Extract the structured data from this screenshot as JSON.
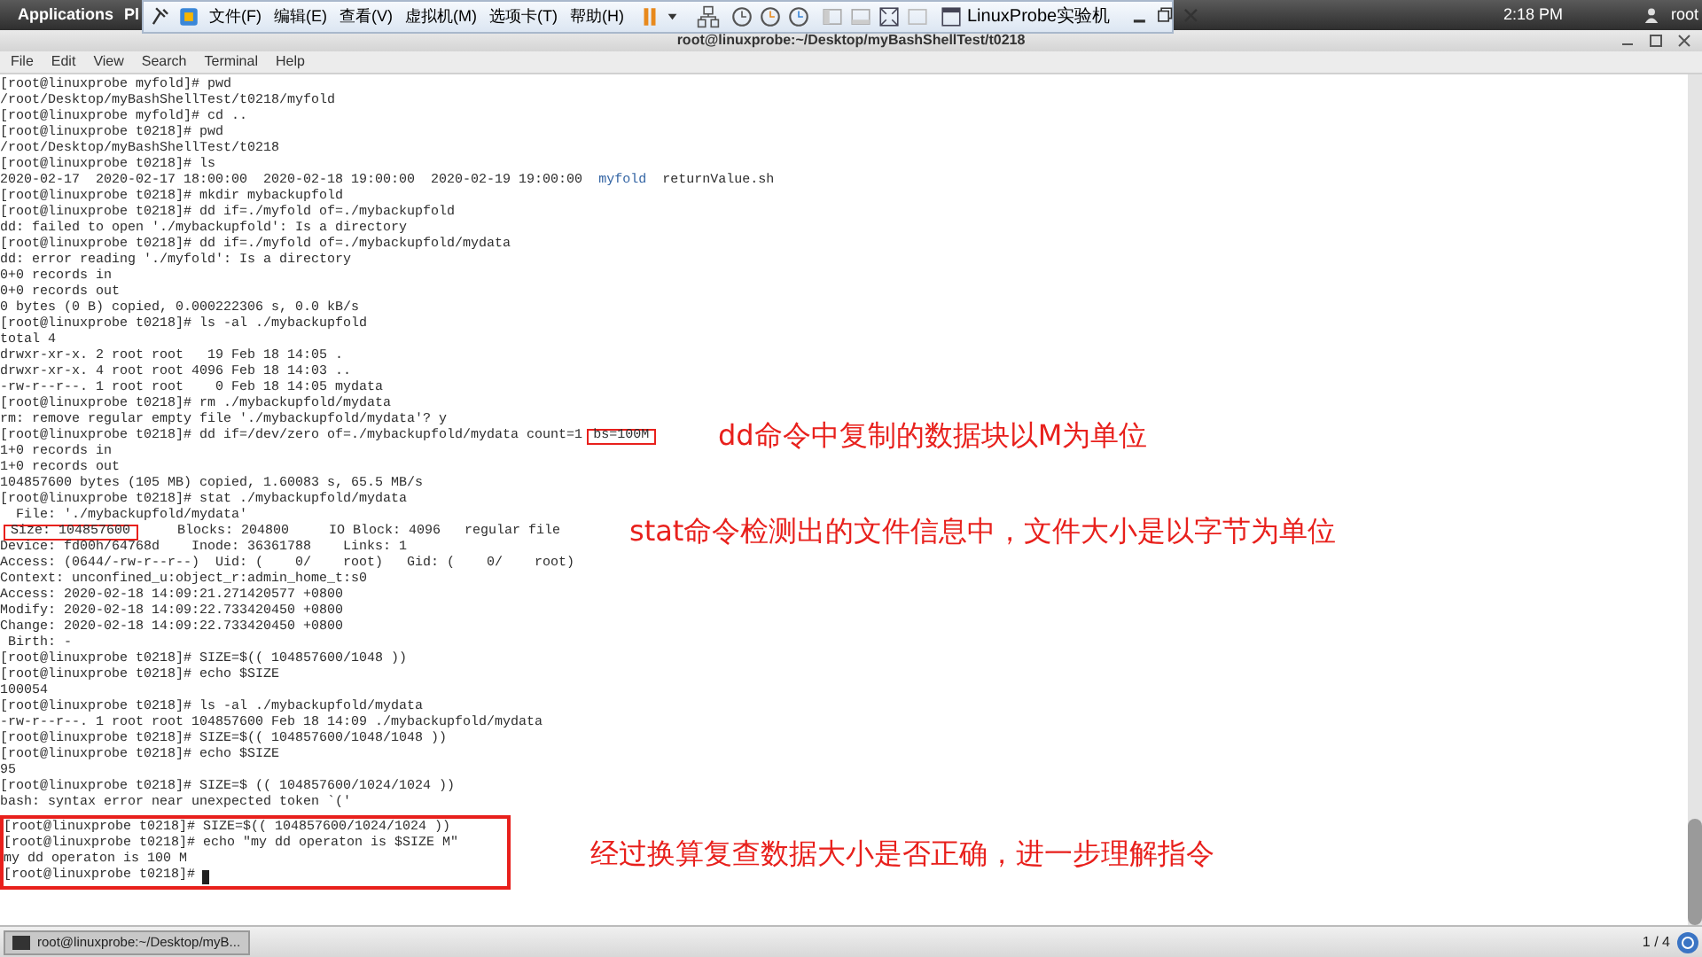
{
  "top_bar": {
    "applications": "Applications",
    "places": "Pl",
    "time": "2:18 PM",
    "user": "root"
  },
  "vm_toolbar": {
    "menus": [
      "文件(F)",
      "编辑(E)",
      "查看(V)",
      "虚拟机(M)",
      "选项卡(T)",
      "帮助(H)"
    ],
    "title": "LinuxProbe实验机"
  },
  "terminal": {
    "title": "root@linuxprobe:~/Desktop/myBashShellTest/t0218",
    "menu": [
      "File",
      "Edit",
      "View",
      "Search",
      "Terminal",
      "Help"
    ],
    "lines": [
      {
        "segments": [
          {
            "text": "[root@linuxprobe myfold]# pwd"
          }
        ]
      },
      {
        "segments": [
          {
            "text": "/root/Desktop/myBashShellTest/t0218/myfold"
          }
        ]
      },
      {
        "segments": [
          {
            "text": "[root@linuxprobe myfold]# cd .."
          }
        ]
      },
      {
        "segments": [
          {
            "text": "[root@linuxprobe t0218]# pwd"
          }
        ]
      },
      {
        "segments": [
          {
            "text": "/root/Desktop/myBashShellTest/t0218"
          }
        ]
      },
      {
        "segments": [
          {
            "text": "[root@linuxprobe t0218]# ls"
          }
        ]
      },
      {
        "segments": [
          {
            "text": "2020-02-17  2020-02-17 18:00:00  2020-02-18 19:00:00  2020-02-19 19:00:00  "
          },
          {
            "text": "myfold",
            "color": "#3465a4"
          },
          {
            "text": "  returnValue.sh"
          }
        ]
      },
      {
        "segments": [
          {
            "text": "[root@linuxprobe t0218]# mkdir mybackupfold"
          }
        ]
      },
      {
        "segments": [
          {
            "text": "[root@linuxprobe t0218]# dd if=./myfold of=./mybackupfold"
          }
        ]
      },
      {
        "segments": [
          {
            "text": "dd: failed to open './mybackupfold': Is a directory"
          }
        ]
      },
      {
        "segments": [
          {
            "text": "[root@linuxprobe t0218]# dd if=./myfold of=./mybackupfold/mydata"
          }
        ]
      },
      {
        "segments": [
          {
            "text": "dd: error reading './myfold': Is a directory"
          }
        ]
      },
      {
        "segments": [
          {
            "text": "0+0 records in"
          }
        ]
      },
      {
        "segments": [
          {
            "text": "0+0 records out"
          }
        ]
      },
      {
        "segments": [
          {
            "text": "0 bytes (0 B) copied, 0.000222306 s, 0.0 kB/s"
          }
        ]
      },
      {
        "segments": [
          {
            "text": "[root@linuxprobe t0218]# ls -al ./mybackupfold"
          }
        ]
      },
      {
        "segments": [
          {
            "text": "total 4"
          }
        ]
      },
      {
        "segments": [
          {
            "text": "drwxr-xr-x. 2 root root   19 Feb 18 14:05 ."
          }
        ]
      },
      {
        "segments": [
          {
            "text": "drwxr-xr-x. 4 root root 4096 Feb 18 14:03 .."
          }
        ]
      },
      {
        "segments": [
          {
            "text": "-rw-r--r--. 1 root root    0 Feb 18 14:05 mydata"
          }
        ]
      },
      {
        "segments": [
          {
            "text": "[root@linuxprobe t0218]# rm ./mybackupfold/mydata"
          }
        ]
      },
      {
        "segments": [
          {
            "text": "rm: remove regular empty file './mybackupfold/mydata'? y"
          }
        ]
      },
      {
        "segments": [
          {
            "text": "[root@linuxprobe t0218]# dd if=/dev/zero of=./mybackupfold/mydata count=1"
          },
          {
            "text": "bs=100M",
            "boxed": true
          }
        ],
        "note": "dd命令中复制的数据块以M为单位"
      },
      {
        "segments": [
          {
            "text": "1+0 records in"
          }
        ]
      },
      {
        "segments": [
          {
            "text": "1+0 records out"
          }
        ]
      },
      {
        "segments": [
          {
            "text": "104857600 bytes (105 MB) copied, 1.60083 s, 65.5 MB/s"
          }
        ]
      },
      {
        "segments": [
          {
            "text": "[root@linuxprobe t0218]# stat ./mybackupfold/mydata"
          }
        ]
      },
      {
        "segments": [
          {
            "text": "  File: './mybackupfold/mydata'"
          }
        ]
      },
      {
        "segments": [
          {
            "text": "Size: 104857600",
            "boxed": true
          },
          {
            "text": "     Blocks: 204800     IO Block: 4096   regular file"
          }
        ],
        "note": "stat命令检测出的文件信息中，文件大小是以字节为单位"
      },
      {
        "segments": [
          {
            "text": "Device: fd00h/64768d    Inode: 36361788    Links: 1"
          }
        ]
      },
      {
        "segments": [
          {
            "text": "Access: (0644/-rw-r--r--)  Uid: (    0/    root)   Gid: (    0/    root)"
          }
        ]
      },
      {
        "segments": [
          {
            "text": "Context: unconfined_u:object_r:admin_home_t:s0"
          }
        ]
      },
      {
        "segments": [
          {
            "text": "Access: 2020-02-18 14:09:21.271420577 +0800"
          }
        ]
      },
      {
        "segments": [
          {
            "text": "Modify: 2020-02-18 14:09:22.733420450 +0800"
          }
        ]
      },
      {
        "segments": [
          {
            "text": "Change: 2020-02-18 14:09:22.733420450 +0800"
          }
        ]
      },
      {
        "segments": [
          {
            "text": " Birth: -"
          }
        ]
      },
      {
        "segments": [
          {
            "text": "[root@linuxprobe t0218]# SIZE=$(( 104857600/1048 ))"
          }
        ]
      },
      {
        "segments": [
          {
            "text": "[root@linuxprobe t0218]# echo $SIZE"
          }
        ]
      },
      {
        "segments": [
          {
            "text": "100054"
          }
        ]
      },
      {
        "segments": [
          {
            "text": "[root@linuxprobe t0218]# ls -al ./mybackupfold/mydata"
          }
        ]
      },
      {
        "segments": [
          {
            "text": "-rw-r--r--. 1 root root 104857600 Feb 18 14:09 ./mybackupfold/mydata"
          }
        ]
      },
      {
        "segments": [
          {
            "text": "[root@linuxprobe t0218]# SIZE=$(( 104857600/1048/1048 ))"
          }
        ]
      },
      {
        "segments": [
          {
            "text": "[root@linuxprobe t0218]# echo $SIZE"
          }
        ]
      },
      {
        "segments": [
          {
            "text": "95"
          }
        ]
      },
      {
        "segments": [
          {
            "text": "[root@linuxprobe t0218]# SIZE=$ (( 104857600/1024/1024 ))"
          }
        ]
      },
      {
        "segments": [
          {
            "text": "bash: syntax error near unexpected token `('"
          }
        ]
      }
    ],
    "boxed_lines": [
      {
        "text": "[root@linuxprobe t0218]# SIZE=$(( 104857600/1024/1024 ))"
      },
      {
        "text": "[root@linuxprobe t0218]# echo \"my dd operaton is $SIZE M\""
      },
      {
        "text": "my dd operaton is 100 M"
      },
      {
        "text": "[root@linuxprobe t0218]#",
        "cursor": true
      }
    ],
    "boxed_note": "经过换算复查数据大小是否正确，进一步理解指令"
  },
  "taskbar": {
    "task": "root@linuxprobe:~/Desktop/myB...",
    "workspace": "1 / 4"
  }
}
